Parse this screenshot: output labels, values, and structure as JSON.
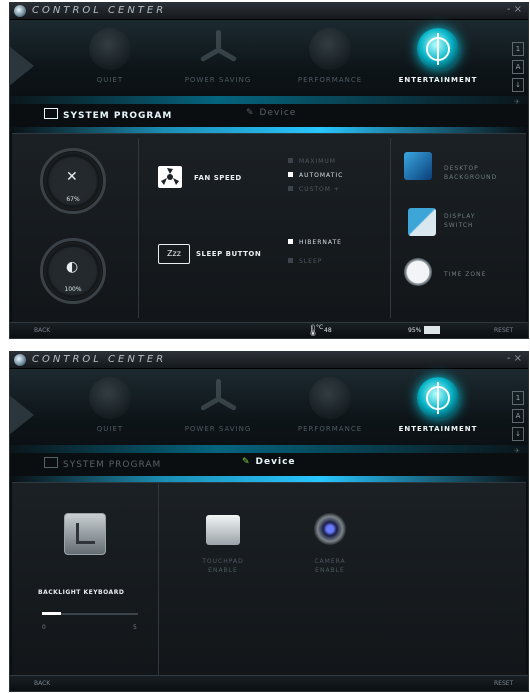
{
  "app": {
    "title": "CONTROL CENTER",
    "window_controls": "- ×"
  },
  "modes": [
    {
      "label": "QUIET",
      "icon": "quiet-mode-icon"
    },
    {
      "label": "POWER SAVING",
      "icon": "power-saving-fan-icon"
    },
    {
      "label": "PERFORMANCE",
      "icon": "performance-icon"
    },
    {
      "label": "ENTERTAINMENT",
      "icon": "entertainment-target-icon",
      "active": true
    }
  ],
  "side_icons": [
    "1",
    "A",
    "↓",
    "✈"
  ],
  "tabs": {
    "system_program": "SYSTEM PROGRAM",
    "device": "Device"
  },
  "screen1": {
    "gauges": [
      {
        "value": "67%",
        "icon": "close-x-icon"
      },
      {
        "value": "100%",
        "icon": "brightness-icon"
      }
    ],
    "fan": {
      "label": "FAN SPEED",
      "options": [
        "MAXIMUM",
        "AUTOMATIC",
        "CUSTOM"
      ],
      "selected": "AUTOMATIC"
    },
    "sleep": {
      "icon_text": "Zzz",
      "label": "SLEEP BUTTON",
      "options": [
        "HIBERNATE",
        "SLEEP"
      ],
      "selected": "HIBERNATE"
    },
    "right": [
      {
        "label_l1": "DESKTOP",
        "label_l2": "BACKGROUND",
        "icon": "desktop-background-icon"
      },
      {
        "label_l1": "DISPLAY",
        "label_l2": "SWITCH",
        "icon": "display-switch-icon"
      },
      {
        "label_l1": "TIME ZONE",
        "label_l2": "",
        "icon": "clock-icon"
      }
    ],
    "status": {
      "back": "BACK",
      "temp": "48",
      "temp_unit": "°C",
      "battery": "95%",
      "reset": "RESET"
    }
  },
  "screen2": {
    "backlight": {
      "label": "BACKLIGHT KEYBOARD",
      "min": "0",
      "max": "5",
      "level_fraction": 0.2
    },
    "touchpad": {
      "label_l1": "TOUCHPAD",
      "label_l2": "ENABLE"
    },
    "camera": {
      "label_l1": "CAMERA",
      "label_l2": "ENABLE"
    },
    "status": {
      "back": "BACK",
      "reset": "RESET"
    }
  },
  "colors": {
    "accent": "#28c6ff",
    "active_mode": "#07b6c9",
    "panel": "#1b2024"
  }
}
